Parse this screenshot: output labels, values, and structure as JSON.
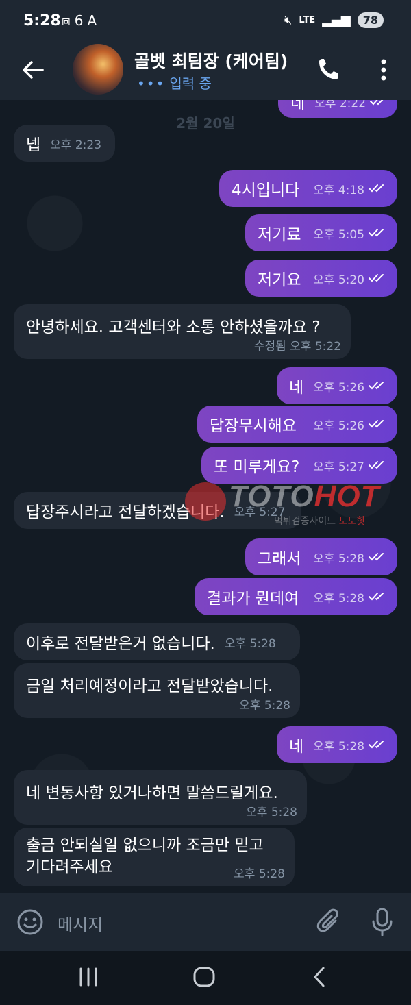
{
  "status_bar": {
    "time": "5:28",
    "notif_icons": [
      "screenshot-icon",
      "six-icon",
      "a-icon"
    ],
    "network": "LTE",
    "battery": "78"
  },
  "header": {
    "title": "골벳 최팀장 (케어팀)",
    "status": "입력 중"
  },
  "chat": {
    "date_separator": "2월 20일",
    "accent_color": "#7b45c8",
    "messages": [
      {
        "dir": "out",
        "text": "네",
        "time": "오후 2:22"
      },
      {
        "dir": "in",
        "text": "넵",
        "time": "오후 2:23"
      },
      {
        "dir": "out",
        "text": "4시입니다",
        "time": "오후 4:18"
      },
      {
        "dir": "out",
        "text": "저기료",
        "time": "오후 5:05"
      },
      {
        "dir": "out",
        "text": "저기요",
        "time": "오후 5:20"
      },
      {
        "dir": "in",
        "text": "안녕하세요. 고객센터와 소통 안하셨을까요 ?",
        "time": "수정됨 오후 5:22"
      },
      {
        "dir": "out",
        "text": "네",
        "time": "오후 5:26"
      },
      {
        "dir": "out",
        "text": "답장무시해요",
        "time": "오후 5:26"
      },
      {
        "dir": "out",
        "text": "또 미루게요?",
        "time": "오후 5:27"
      },
      {
        "dir": "in",
        "text": "답장주시라고 전달하겠습니다.",
        "time": "오후 5:27"
      },
      {
        "dir": "out",
        "text": "그래서",
        "time": "오후 5:28"
      },
      {
        "dir": "out",
        "text": "결과가 뭔데여",
        "time": "오후 5:28"
      },
      {
        "dir": "in",
        "text": "이후로 전달받은거 없습니다.",
        "time": "오후 5:28"
      },
      {
        "dir": "in",
        "text": "금일 처리예정이라고 전달받았습니다.",
        "time": "오후 5:28"
      },
      {
        "dir": "out",
        "text": "네",
        "time": "오후 5:28"
      },
      {
        "dir": "in",
        "text": "네 변동사항 있거나하면 말씀드릴게요.",
        "time": "오후 5:28"
      },
      {
        "dir": "in",
        "text": "출금 안되실일 없으니까 조금만 믿고",
        "text2": "기다려주세요",
        "time": "오후 5:28"
      }
    ]
  },
  "watermark": {
    "brand_a": "TOTO",
    "brand_b": "HOT",
    "sub_a": "먹튀검증사이트",
    "sub_b": "토토핫"
  },
  "input": {
    "placeholder": "메시지"
  }
}
